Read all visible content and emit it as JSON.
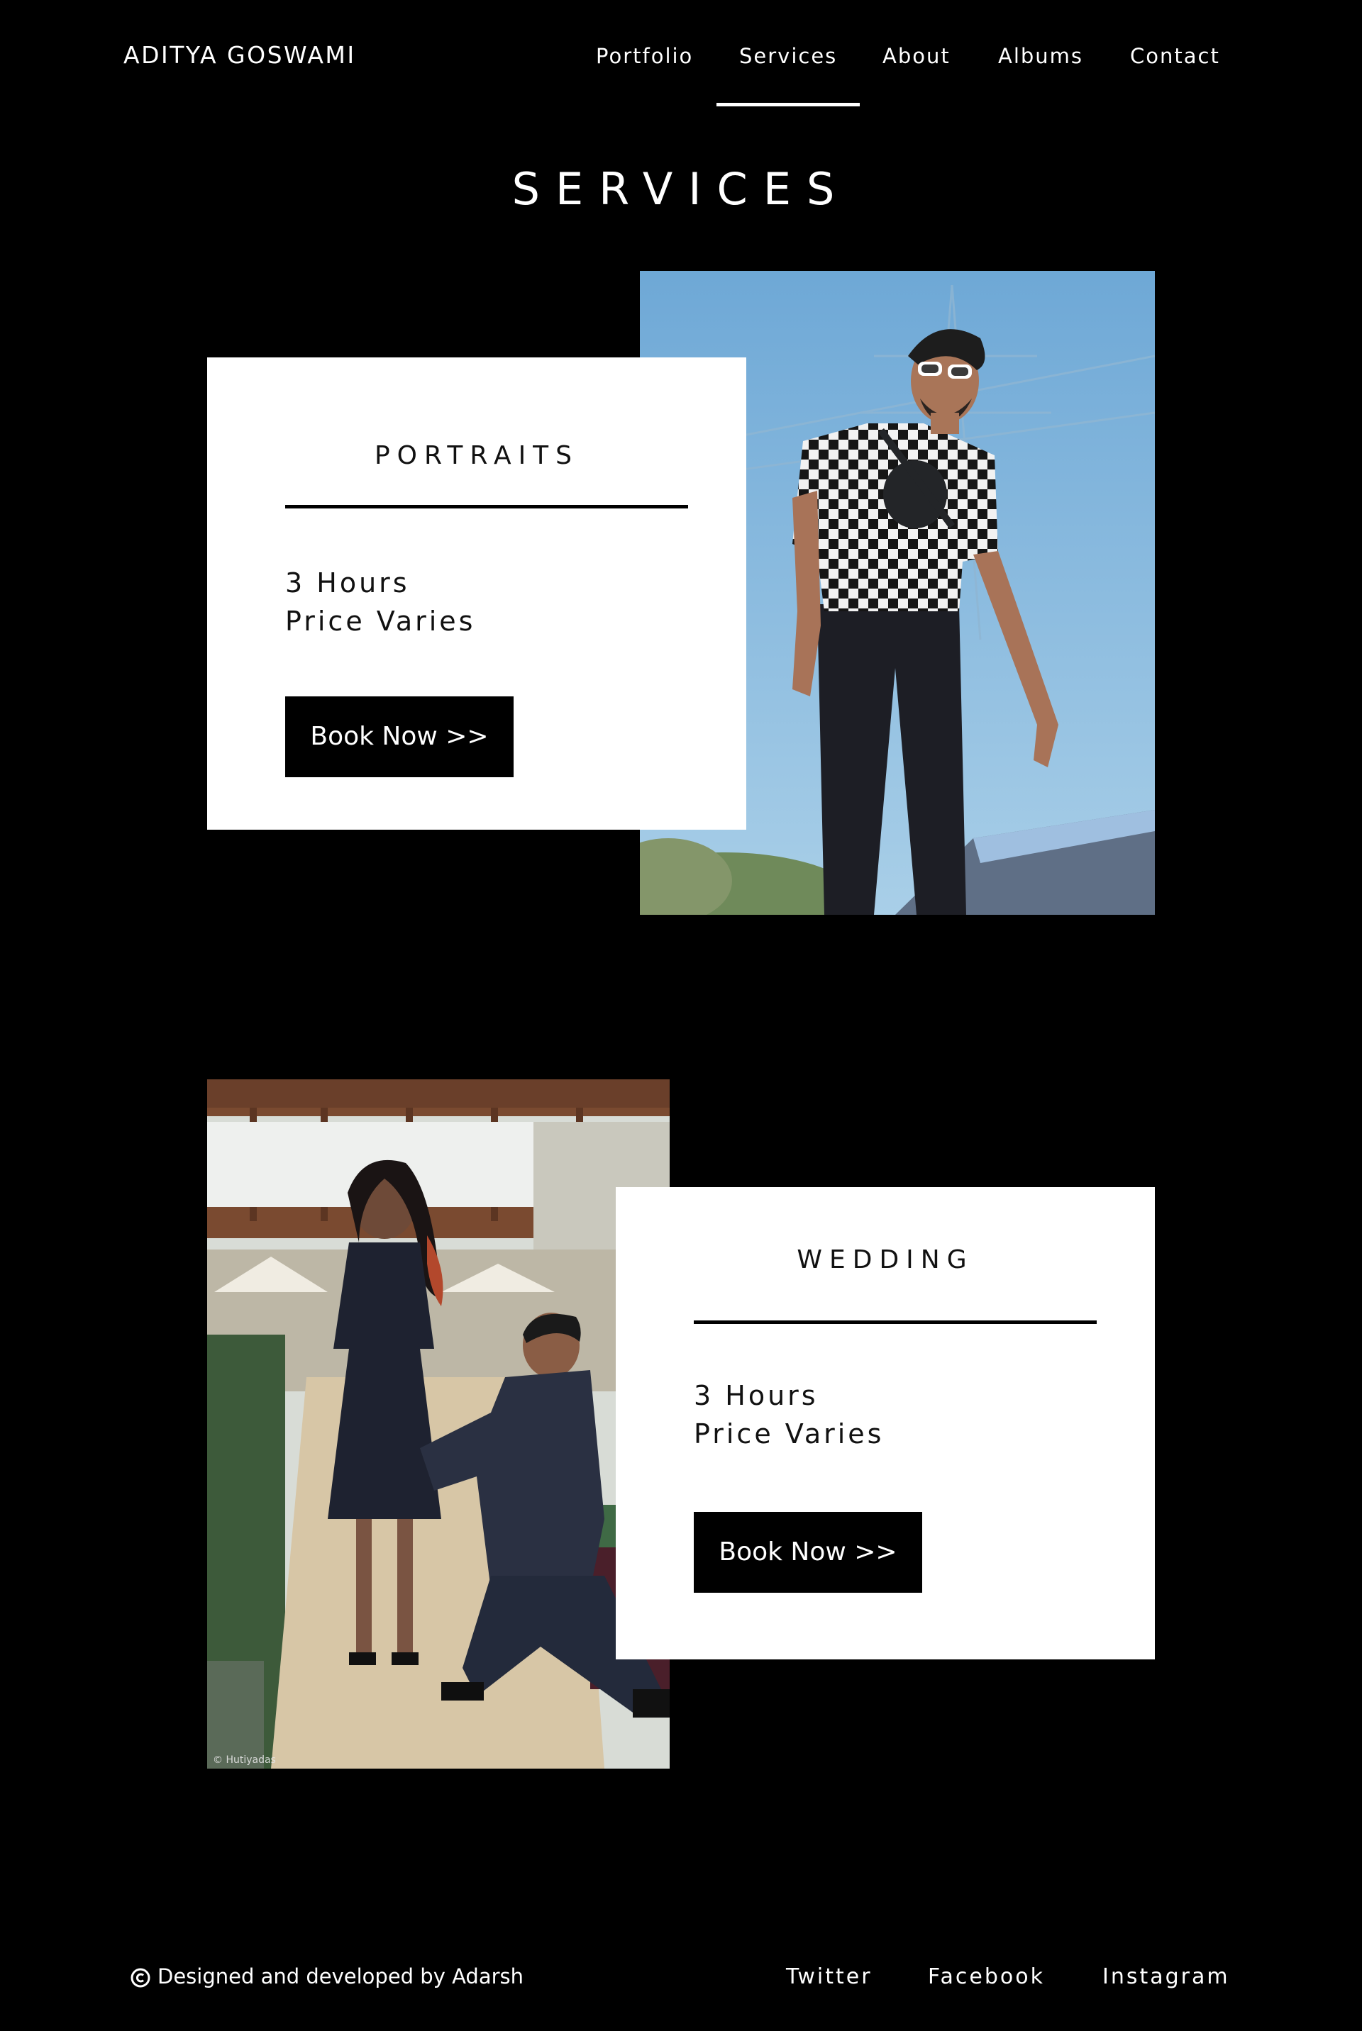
{
  "header": {
    "brand": "ADITYA GOSWAMI",
    "nav": [
      {
        "label": "Portfolio"
      },
      {
        "label": "Services",
        "active": true
      },
      {
        "label": "About"
      },
      {
        "label": "Albums"
      },
      {
        "label": "Contact"
      }
    ]
  },
  "page": {
    "title": "SERVICES"
  },
  "services": [
    {
      "title": "PORTRAITS",
      "duration": "3 Hours",
      "price": "Price Varies",
      "button": "Book Now >>"
    },
    {
      "title": "WEDDING",
      "duration": "3 Hours",
      "price": "Price Varies",
      "button": "Book Now >>"
    }
  ],
  "photos": {
    "wedding_watermark": "© Hutiyadas"
  },
  "footer": {
    "credit": "Designed and developed by Adarsh",
    "social": [
      "Twitter",
      "Facebook",
      "Instagram"
    ]
  },
  "colors": {
    "background": "#000000",
    "card": "#ffffff",
    "button": "#000000",
    "text": "#ffffff"
  }
}
